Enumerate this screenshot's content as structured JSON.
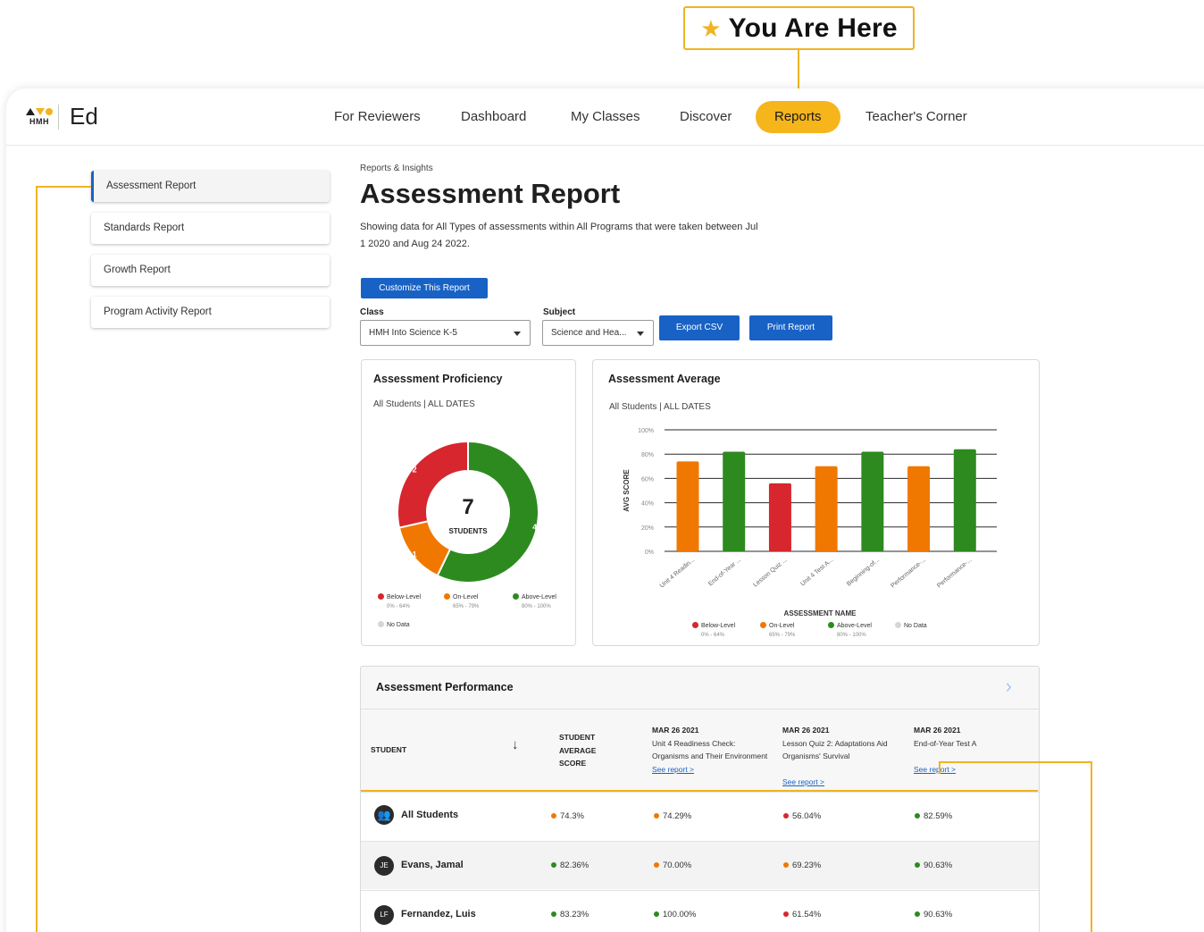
{
  "callout": {
    "text": "You Are Here"
  },
  "colors": {
    "accent": "#f5b51b",
    "callout_border": "#f0b323",
    "primary": "#1862c6",
    "below": "#d7262d",
    "on": "#f07800",
    "above": "#2d8a1f",
    "nodata": "#d6d6d6"
  },
  "brand": {
    "company": "HMH",
    "product": "Ed"
  },
  "nav": {
    "items": [
      {
        "label": "For Reviewers"
      },
      {
        "label": "Dashboard"
      },
      {
        "label": "My Classes"
      },
      {
        "label": "Discover"
      },
      {
        "label": "Reports"
      },
      {
        "label": "Teacher's Corner"
      }
    ],
    "active": "Reports"
  },
  "sidebar": {
    "items": [
      {
        "label": "Assessment Report"
      },
      {
        "label": "Standards Report"
      },
      {
        "label": "Growth Report"
      },
      {
        "label": "Program Activity Report"
      }
    ],
    "active": "Assessment Report"
  },
  "header": {
    "breadcrumb": "Reports & Insights",
    "title": "Assessment Report",
    "description": "Showing data for All Types of assessments within All Programs that were taken between Jul 1 2020 and Aug 24 2022."
  },
  "controls": {
    "customize_label": "Customize This Report",
    "class_label": "Class",
    "class_value": "HMH Into Science K-5",
    "subject_label": "Subject",
    "subject_value": "Science and Hea...",
    "export_label": "Export CSV",
    "print_label": "Print Report"
  },
  "proficiency": {
    "title": "Assessment Proficiency",
    "subtitle": "All Students | ALL DATES",
    "total": "7",
    "total_label": "STUDENTS",
    "segments": [
      {
        "label": "Below-Level",
        "count": 2,
        "count_text": "2"
      },
      {
        "label": "On-Level",
        "count": 1,
        "count_text": "1"
      },
      {
        "label": "Above-Level",
        "count": 4,
        "count_text": "4"
      }
    ],
    "legend": [
      {
        "label": "Below-Level",
        "range": "0% - 64%"
      },
      {
        "label": "On-Level",
        "range": "65% - 79%"
      },
      {
        "label": "Above-Level",
        "range": "80% - 100%"
      },
      {
        "label": "No Data",
        "range": ""
      }
    ]
  },
  "chart_data": {
    "type": "bar",
    "title": "Assessment Average",
    "subtitle": "All Students | ALL DATES",
    "xlabel": "ASSESSMENT NAME",
    "ylabel": "AVG SCORE",
    "ylim": [
      0,
      100
    ],
    "yticks": [
      "0%",
      "20%",
      "40%",
      "60%",
      "80%",
      "100%"
    ],
    "categories": [
      "Unit 4 Readin...",
      "End-of-Year ...",
      "Lesson Quiz ...",
      "Unit 4 Test A...",
      "Beginning-of...",
      "Performance-...",
      "Performance-..."
    ],
    "values": [
      74,
      82,
      56,
      70,
      82,
      70,
      84
    ],
    "levels": [
      "on",
      "above",
      "below",
      "on",
      "above",
      "on",
      "above"
    ],
    "legend": [
      {
        "label": "Below-Level",
        "range": "0% - 64%"
      },
      {
        "label": "On-Level",
        "range": "65% - 79%"
      },
      {
        "label": "Above-Level",
        "range": "80% - 100%"
      },
      {
        "label": "No Data",
        "range": ""
      }
    ]
  },
  "performance": {
    "title": "Assessment Performance",
    "col_student": "STUDENT",
    "col_average": "STUDENT AVERAGE SCORE",
    "assessments": [
      {
        "date": "MAR 26 2021",
        "name": "Unit 4 Readiness Check: Organisms and Their Environment",
        "link": "See report >"
      },
      {
        "date": "MAR 26 2021",
        "name": "Lesson Quiz 2: Adaptations Aid Organisms' Survival",
        "link": "See report >"
      },
      {
        "date": "MAR 26 2021",
        "name": "End-of-Year Test A",
        "link": "See report >"
      }
    ],
    "rows": [
      {
        "name": "All Students",
        "initials": "",
        "avg": "74.3%",
        "avg_level": "on",
        "scores": [
          "74.29%",
          "56.04%",
          "82.59%"
        ],
        "levels": [
          "on",
          "below",
          "above"
        ]
      },
      {
        "name": "Evans, Jamal",
        "initials": "JE",
        "avg": "82.36%",
        "avg_level": "above",
        "scores": [
          "70.00%",
          "69.23%",
          "90.63%"
        ],
        "levels": [
          "on",
          "on",
          "above"
        ]
      },
      {
        "name": "Fernandez, Luis",
        "initials": "LF",
        "avg": "83.23%",
        "avg_level": "above",
        "scores": [
          "100.00%",
          "61.54%",
          "90.63%"
        ],
        "levels": [
          "above",
          "below",
          "above"
        ]
      }
    ]
  }
}
